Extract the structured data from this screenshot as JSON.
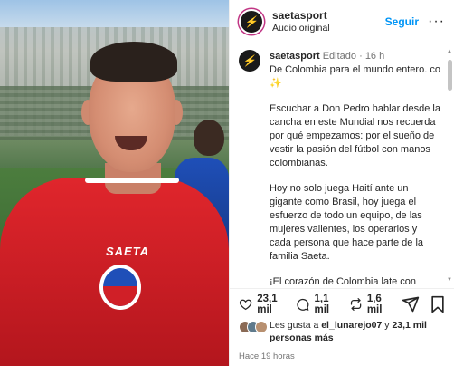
{
  "header": {
    "username": "saetasport",
    "subtitle": "Audio original",
    "follow_label": "Seguir",
    "more_icon": "more-horizontal-icon"
  },
  "media": {
    "shirt_brand": "SAETA"
  },
  "caption": {
    "username": "saetasport",
    "edited": "Editado",
    "separator": "·",
    "age": "16 h",
    "paragraphs": [
      "De Colombia para el mundo entero. co ✨",
      "Escuchar a Don Pedro hablar desde la cancha en este Mundial nos recuerda por qué empezamos: por el sueño de vestir la pasión del fútbol con manos colombianas.",
      "Hoy no solo juega Haití ante un gigante como Brasil, hoy juega el esfuerzo de todo un equipo, de las mujeres valientes, los operarios y cada persona que hace parte de la familia Saeta.",
      "¡El corazón de Colombia late con fuerza en los escenarios más grandes!"
    ]
  },
  "actions": {
    "likes_count": "23,1 mil",
    "comments_count": "1,1 mil",
    "shares_count": "1,6 mil"
  },
  "likes": {
    "prefix": "Les gusta a",
    "user": "el_lunarejo07",
    "connector": "y",
    "others": "23,1 mil personas más"
  },
  "timestamp": "Hace 19 horas",
  "colors": {
    "follow": "#0095f6",
    "shirt": "#d01f27",
    "text": "#262626",
    "muted": "#737373"
  }
}
